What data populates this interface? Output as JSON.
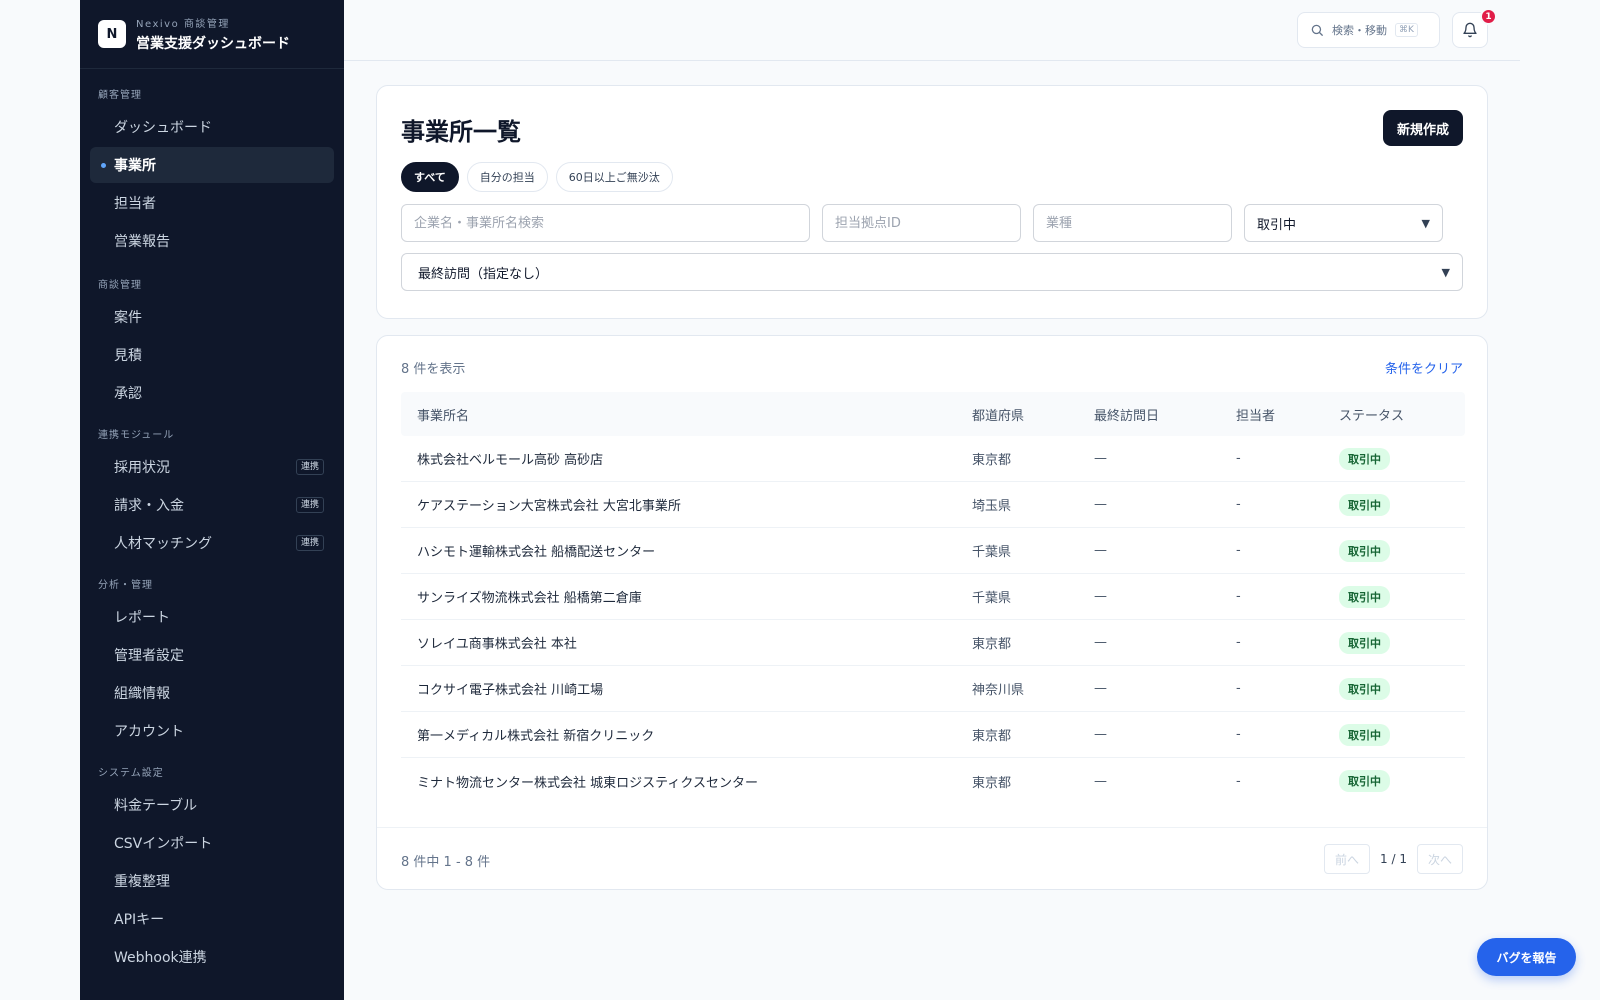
{
  "brand": {
    "logo_letter": "N",
    "subtitle": "Nexivo 商談管理",
    "title": "営業支援ダッシュボード"
  },
  "sidebar": {
    "sections": [
      {
        "label": "顧客管理",
        "items": [
          {
            "label": "ダッシュボード",
            "badge": "",
            "active": false
          },
          {
            "label": "事業所",
            "badge": "",
            "active": true
          },
          {
            "label": "担当者",
            "badge": "",
            "active": false
          },
          {
            "label": "営業報告",
            "badge": "",
            "active": false
          }
        ]
      },
      {
        "label": "商談管理",
        "items": [
          {
            "label": "案件",
            "badge": "",
            "active": false
          },
          {
            "label": "見積",
            "badge": "",
            "active": false
          },
          {
            "label": "承認",
            "badge": "",
            "active": false
          }
        ]
      },
      {
        "label": "連携モジュール",
        "items": [
          {
            "label": "採用状況",
            "badge": "連携",
            "active": false
          },
          {
            "label": "請求・入金",
            "badge": "連携",
            "active": false
          },
          {
            "label": "人材マッチング",
            "badge": "連携",
            "active": false
          }
        ]
      },
      {
        "label": "分析・管理",
        "items": [
          {
            "label": "レポート",
            "badge": "",
            "active": false
          },
          {
            "label": "管理者設定",
            "badge": "",
            "active": false
          },
          {
            "label": "組織情報",
            "badge": "",
            "active": false
          },
          {
            "label": "アカウント",
            "badge": "",
            "active": false
          }
        ]
      },
      {
        "label": "システム設定",
        "items": [
          {
            "label": "料金テーブル",
            "badge": "",
            "active": false
          },
          {
            "label": "CSVインポート",
            "badge": "",
            "active": false
          },
          {
            "label": "重複整理",
            "badge": "",
            "active": false
          },
          {
            "label": "APIキー",
            "badge": "",
            "active": false
          },
          {
            "label": "Webhook連携",
            "badge": "",
            "active": false
          }
        ]
      }
    ]
  },
  "topbar": {
    "search_label": "検索・移動",
    "search_shortcut": "⌘K",
    "notification_count": "1"
  },
  "page": {
    "title": "事業所一覧",
    "new_button": "新規作成",
    "chips": [
      {
        "label": "すべて",
        "active": true
      },
      {
        "label": "自分の担当",
        "active": false
      },
      {
        "label": "60日以上ご無沙汰",
        "active": false
      }
    ],
    "filters": {
      "name_placeholder": "企業名・事業所名検索",
      "base_placeholder": "担当拠点ID",
      "industry_placeholder": "業種",
      "status_value": "取引中",
      "last_visit_value": "最終訪問（指定なし）"
    }
  },
  "table": {
    "count_text": "8 件を表示",
    "clear_label": "条件をクリア",
    "headers": [
      "事業所名",
      "都道府県",
      "最終訪問日",
      "担当者",
      "ステータス"
    ],
    "rows": [
      [
        "株式会社ベルモール高砂 高砂店",
        "東京都",
        "—",
        "-",
        "取引中"
      ],
      [
        "ケアステーション大宮株式会社 大宮北事業所",
        "埼玉県",
        "—",
        "-",
        "取引中"
      ],
      [
        "ハシモト運輸株式会社 船橋配送センター",
        "千葉県",
        "—",
        "-",
        "取引中"
      ],
      [
        "サンライズ物流株式会社 船橋第二倉庫",
        "千葉県",
        "—",
        "-",
        "取引中"
      ],
      [
        "ソレイユ商事株式会社 本社",
        "東京都",
        "—",
        "-",
        "取引中"
      ],
      [
        "コクサイ電子株式会社 川崎工場",
        "神奈川県",
        "—",
        "-",
        "取引中"
      ],
      [
        "第一メディカル株式会社 新宿クリニック",
        "東京都",
        "—",
        "-",
        "取引中"
      ],
      [
        "ミナト物流センター株式会社 城東ロジスティクスセンター",
        "東京都",
        "—",
        "-",
        "取引中"
      ]
    ],
    "range_text": "8 件中 1 - 8 件",
    "prev_label": "前へ",
    "page_indicator": "1 / 1",
    "next_label": "次へ"
  },
  "bug_report_label": "バグを報告",
  "colors": {
    "sidebar_bg": "#0f172a",
    "accent": "#2563eb",
    "status_bg": "#dcfce7",
    "status_text": "#166534",
    "notification": "#e11d48"
  }
}
